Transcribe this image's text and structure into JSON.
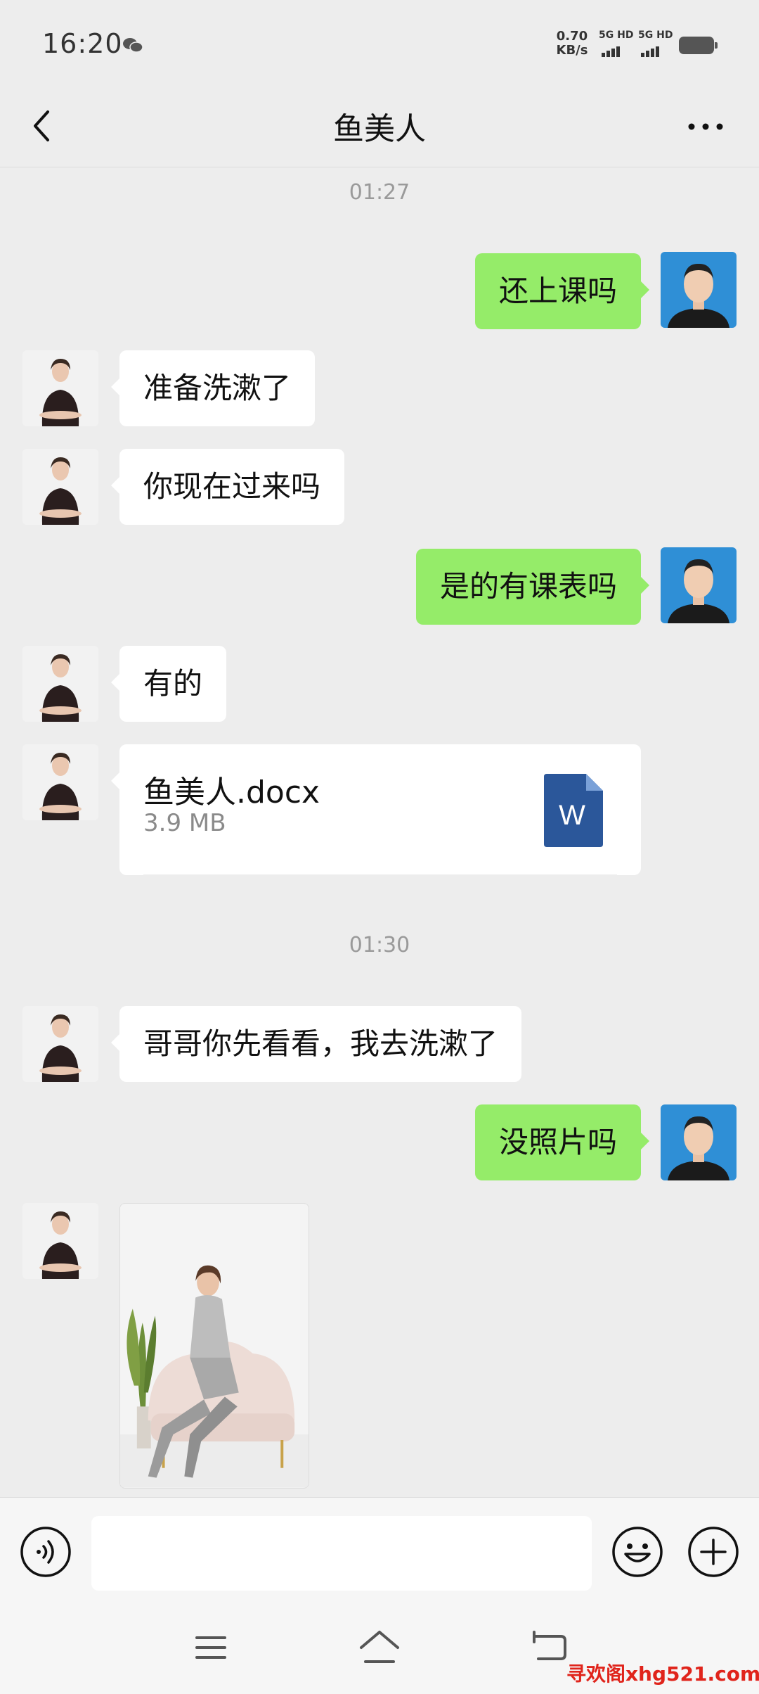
{
  "status_bar": {
    "time": "16:20",
    "net_speed_value": "0.70",
    "net_speed_unit": "KB/s",
    "signal_1": "5G HD",
    "signal_2": "5G HD"
  },
  "header": {
    "title": "鱼美人"
  },
  "chat": {
    "timestamps": [
      "01:27",
      "01:30"
    ],
    "messages": [
      {
        "from": "me",
        "text": "还上课吗"
      },
      {
        "from": "contact",
        "text": "准备洗漱了"
      },
      {
        "from": "contact",
        "text": "你现在过来吗"
      },
      {
        "from": "me",
        "text": "是的有课表吗"
      },
      {
        "from": "contact",
        "text": "有的"
      },
      {
        "from": "contact",
        "type": "file",
        "file_name": "鱼美人.docx",
        "file_size": "3.9 MB",
        "file_icon_letter": "W"
      },
      {
        "from": "contact",
        "text": "哥哥你先看看，我去洗漱了"
      },
      {
        "from": "me",
        "text": "没照片吗"
      },
      {
        "from": "contact",
        "type": "image"
      }
    ]
  },
  "input_bar": {
    "text_value": ""
  },
  "watermark": "寻欢阁xhg521.com",
  "colors": {
    "outgoing_bubble": "#95ec69",
    "incoming_bubble": "#ffffff",
    "background": "#ededed",
    "word_icon": "#2b579a",
    "watermark": "#e0241b"
  }
}
